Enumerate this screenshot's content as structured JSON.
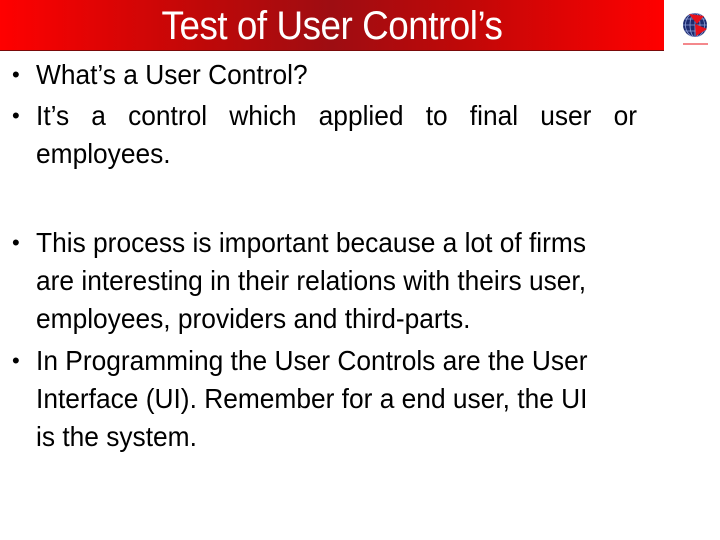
{
  "slide": {
    "title": "Test of User Control’s",
    "colors": {
      "banner_edge": "#ff0000",
      "banner_center": "#9e0d12",
      "title_text": "#ffffff",
      "body_text": "#000000",
      "logo_globe": "#1c2a6e",
      "logo_accent": "#e8101a"
    },
    "logo": {
      "icon": "globe-logo-icon"
    },
    "bullets": [
      {
        "bullet": "•",
        "lines": [
          "What’s a User Control?"
        ]
      },
      {
        "bullet": "•",
        "lines": [
          "It’s  a  control  which  applied  to  final  user  or",
          "employees."
        ]
      },
      {
        "bullet": "•",
        "lines": [
          "This process is important because a lot of firms",
          "are interesting in their relations with theirs user,",
          "employees, providers and third-parts."
        ]
      },
      {
        "bullet": "•",
        "lines": [
          "In Programming the User Controls are the User",
          "Interface (UI). Remember for a end user, the UI",
          "is the system."
        ]
      }
    ]
  }
}
